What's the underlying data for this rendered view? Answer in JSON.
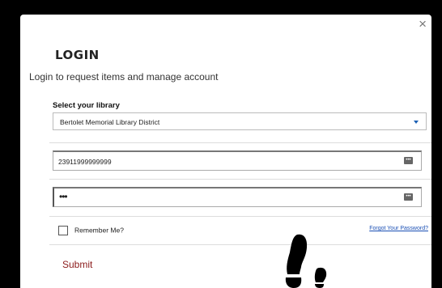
{
  "dialog": {
    "close_symbol": "×",
    "title": "LOGIN",
    "subtitle": "Login to request items and manage account"
  },
  "library": {
    "label": "Select your library",
    "selected": "Bertolet Memorial Library District"
  },
  "card_field": {
    "value": "23911999999999",
    "icon": "key-icon"
  },
  "password_field": {
    "value": "•••",
    "icon": "key-icon"
  },
  "remember": {
    "label": "Remember Me?",
    "checked": false
  },
  "forgot_link": "Forgot Your Password?",
  "submit_label": "Submit",
  "colors": {
    "submit": "#8b1a1a",
    "link": "#1a4fb4",
    "caret": "#1a5fb4"
  }
}
